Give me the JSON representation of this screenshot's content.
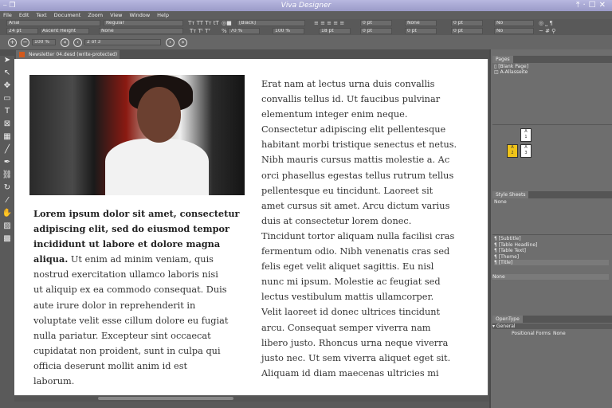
{
  "app": {
    "title": "Viva Designer"
  },
  "menu": [
    "File",
    "Edit",
    "Text",
    "Document",
    "Zoom",
    "View",
    "Window",
    "Help"
  ],
  "toolbar": {
    "font": "Arial",
    "style": "Regular",
    "size": "24 pt",
    "leading_mode": "Ascent Height",
    "underline": "None",
    "color": "[Black]",
    "tint": "70 %",
    "opacity": "100 %",
    "para_leading": "18 pt",
    "space_before": "0 pt",
    "space_after": "0 pt",
    "columns": "None",
    "col_gap": "0 pt",
    "indent_left": "0 pt",
    "indent_right": "0 pt",
    "keep_lines": "No",
    "keep_next": "No"
  },
  "nav": {
    "zoom": "100 %",
    "page": "2 of 3"
  },
  "tab": {
    "label": "Newsletter 04.desd (write-protected)"
  },
  "document": {
    "left_bold": [
      "Lorem ipsum dolor sit amet, consectetur",
      "adipiscing elit, sed do eiusmod tempor",
      "incididunt ut labore et dolore magna",
      "aliqua."
    ],
    "left_lines": [
      " Ut enim ad minim veniam, quis",
      "nostrud exercitation ullamco laboris nisi",
      "ut aliquip ex ea commodo consequat. Duis",
      "aute irure dolor in reprehenderit in",
      "voluptate velit esse cillum dolore eu fugiat",
      "nulla pariatur. Excepteur sint occaecat",
      "cupidatat non proident, sunt in culpa qui",
      "officia deserunt mollit anim id est",
      "laborum."
    ],
    "right_lines": [
      "Erat nam at lectus urna duis convallis",
      "convallis tellus id. Ut faucibus pulvinar",
      "elementum integer enim neque.",
      "Consectetur adipiscing elit pellentesque",
      "habitant morbi tristique senectus et netus.",
      "Nibh mauris cursus mattis molestie a. Ac",
      "orci phasellus egestas tellus rutrum tellus",
      "pellentesque eu tincidunt. Laoreet sit",
      "amet cursus sit amet. Arcu dictum varius",
      "duis at consectetur lorem donec.",
      "Tincidunt tortor aliquam nulla facilisi cras",
      "fermentum odio. Nibh venenatis cras sed",
      "felis eget velit aliquet sagittis. Eu nisl",
      "nunc mi ipsum. Molestie ac feugiat sed",
      "lectus vestibulum mattis ullamcorper.",
      "Velit laoreet id donec ultrices tincidunt",
      "arcu. Consequat semper viverra nam",
      "libero justo. Rhoncus urna neque viverra",
      "justo nec. Ut sem viverra aliquet eget sit.",
      "Aliquam id diam maecenas ultricies mi"
    ]
  },
  "panels": {
    "pages": {
      "title": "Pages",
      "masters": [
        "[Blank Page]",
        "A-Allasseite"
      ],
      "thumbs": [
        {
          "label": "A\n1"
        },
        {
          "label": "A\n2",
          "selected": true
        },
        {
          "label": "A\n3"
        }
      ],
      "selected_color": "#f0c419"
    },
    "stylesheets": {
      "title": "Style Sheets",
      "top": "None",
      "items": [
        "[Subtitle]",
        "[Table Headline]",
        "[Table Text]",
        "[Theme]",
        "[Title]"
      ],
      "bottom": "None"
    },
    "opentype": {
      "title": "OpenType",
      "group": "General",
      "prop_label": "Positional Forms",
      "prop_value": "None"
    }
  }
}
